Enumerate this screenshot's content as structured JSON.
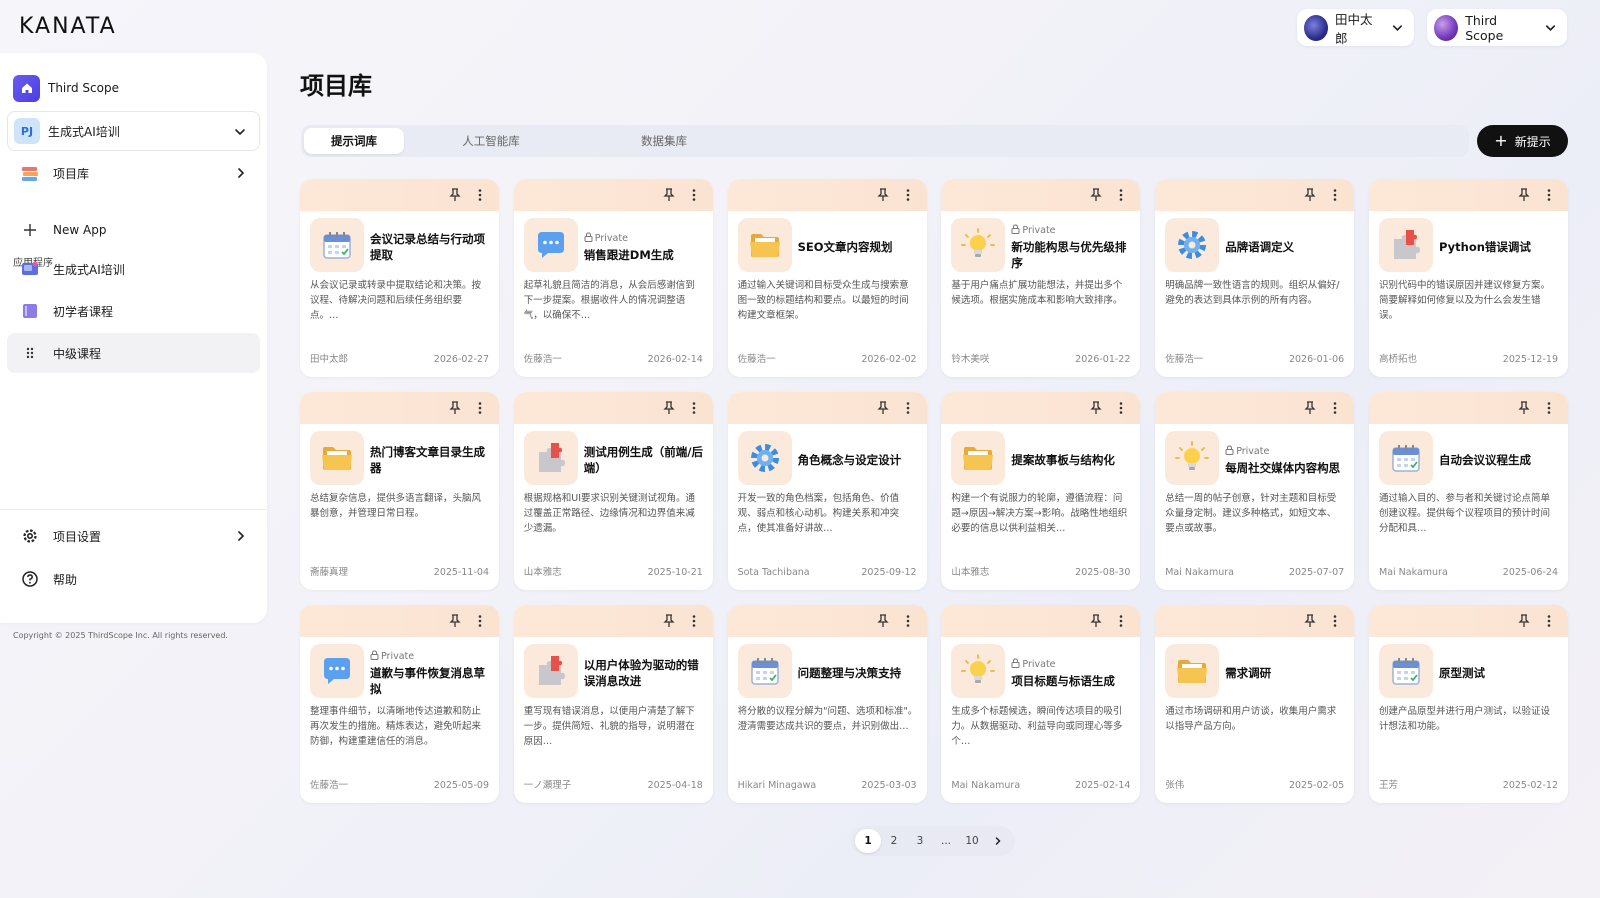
{
  "app": {
    "logo": "KANATA"
  },
  "header": {
    "user": {
      "name": "田中太郎"
    },
    "org": {
      "name": "Third Scope"
    }
  },
  "sidebar": {
    "workspace": "Third Scope",
    "project": {
      "badge": "PJ",
      "name": "生成式AI培训"
    },
    "library": "项目库",
    "section_label": "应用程序",
    "apps": [
      "New App",
      "生成式AI培训",
      "初学者课程",
      "中级课程"
    ],
    "settings": "项目设置",
    "help": "帮助"
  },
  "copyright": "Copyright © 2025 ThirdScope Inc. All rights reserved.",
  "page": {
    "title": "项目库",
    "tabs": [
      "提示词库",
      "人工智能库",
      "数据集库"
    ],
    "active_tab": "提示词库",
    "new_button": "新提示"
  },
  "cards": [
    {
      "icon": "calendar-icon",
      "private": false,
      "title": "会议记录总结与行动项提取",
      "desc": "从会议记录或转录中提取结论和决策。按议程、待解决问题和后续任务组织要点。…",
      "author": "田中太郎",
      "date": "2026-02-27"
    },
    {
      "icon": "chat-bubble-icon",
      "private": true,
      "title": "销售跟进DM生成",
      "desc": "起草礼貌且简洁的消息，从会后感谢信到下一步提案。根据收件人的情况调整语气，以确保不…",
      "author": "佐藤浩一",
      "date": "2026-02-14"
    },
    {
      "icon": "folder-icon",
      "private": false,
      "title": "SEO文章内容规划",
      "desc": "通过输入关键词和目标受众生成与搜索意图一致的标题结构和要点。以最短的时间构建文章框架。",
      "author": "佐藤浩一",
      "date": "2026-02-02"
    },
    {
      "icon": "lightbulb-icon",
      "private": true,
      "title": "新功能构思与优先级排序",
      "desc": "基于用户痛点扩展功能想法，并提出多个候选项。根据实施成本和影响大致排序。",
      "author": "铃木美咲",
      "date": "2026-01-22"
    },
    {
      "icon": "gear-icon",
      "private": false,
      "title": "品牌语调定义",
      "desc": "明确品牌一致性语言的规则。组织从偏好/避免的表达到具体示例的所有内容。",
      "author": "佐藤浩一",
      "date": "2026-01-06"
    },
    {
      "icon": "puzzle-icon",
      "private": false,
      "title": "Python错误调试",
      "desc": "识别代码中的错误原因并建议修复方案。简要解释如何修复以及为什么会发生错误。",
      "author": "高桥拓也",
      "date": "2025-12-19"
    },
    {
      "icon": "folder-icon",
      "private": false,
      "title": "热门博客文章目录生成器",
      "desc": "总结复杂信息，提供多语言翻译，头脑风暴创意，并管理日常日程。",
      "author": "斋藤真理",
      "date": "2025-11-04"
    },
    {
      "icon": "puzzle-icon",
      "private": false,
      "title": "测试用例生成（前端/后端）",
      "desc": "根据规格和UI要求识别关键测试视角。通过覆盖正常路径、边缘情况和边界值来减少遗漏。",
      "author": "山本雅志",
      "date": "2025-10-21"
    },
    {
      "icon": "gear-icon",
      "private": false,
      "title": "角色概念与设定设计",
      "desc": "开发一致的角色档案，包括角色、价值观、弱点和核心动机。构建关系和冲突点，使其准备好讲故…",
      "author": "Sota Tachibana",
      "date": "2025-09-12"
    },
    {
      "icon": "folder-icon",
      "private": false,
      "title": "提案故事板与结构化",
      "desc": "构建一个有说服力的轮廓，遵循流程：问题→原因→解决方案→影响。战略性地组织必要的信息以供利益相关…",
      "author": "山本雅志",
      "date": "2025-08-30"
    },
    {
      "icon": "lightbulb-icon",
      "private": true,
      "title": "每周社交媒体内容构思",
      "desc": "总结一周的帖子创意，针对主题和目标受众量身定制。建议多种格式，如短文本、要点或故事。",
      "author": "Mai Nakamura",
      "date": "2025-07-07"
    },
    {
      "icon": "calendar-icon",
      "private": false,
      "title": "自动会议议程生成",
      "desc": "通过输入目的、参与者和关键讨论点简单创建议程。提供每个议程项目的预计时间分配和具…",
      "author": "Mai Nakamura",
      "date": "2025-06-24"
    },
    {
      "icon": "chat-bubble-icon",
      "private": true,
      "title": "道歉与事件恢复消息草拟",
      "desc": "整理事件细节，以清晰地传达道歉和防止再次发生的措施。精炼表达，避免听起来防御，构建重建信任的消息。",
      "author": "佐藤浩一",
      "date": "2025-05-09"
    },
    {
      "icon": "puzzle-icon",
      "private": false,
      "title": "以用户体验为驱动的错误消息改进",
      "desc": "重写现有错误消息，以便用户清楚了解下一步。提供简短、礼貌的指导，说明潜在原因…",
      "author": "一ノ瀬理子",
      "date": "2025-04-18"
    },
    {
      "icon": "calendar-icon",
      "private": false,
      "title": "问题整理与决策支持",
      "desc": "将分散的议程分解为\"问题、选项和标准\"。澄清需要达成共识的要点，并识别做出…",
      "author": "Hikari Minagawa",
      "date": "2025-03-03"
    },
    {
      "icon": "lightbulb-icon",
      "private": true,
      "title": "项目标题与标语生成",
      "desc": "生成多个标题候选，瞬间传达项目的吸引力。从数据驱动、利益导向或同理心等多个…",
      "author": "Mai Nakamura",
      "date": "2025-02-14"
    },
    {
      "icon": "folder-icon",
      "private": false,
      "title": "需求调研",
      "desc": "通过市场调研和用户访谈，收集用户需求以指导产品方向。",
      "author": "张伟",
      "date": "2025-02-05"
    },
    {
      "icon": "calendar-icon",
      "private": false,
      "title": "原型测试",
      "desc": "创建产品原型并进行用户测试，以验证设计想法和功能。",
      "author": "王芳",
      "date": "2025-02-12"
    }
  ],
  "private_label": "Private",
  "pagination": {
    "pages": [
      "1",
      "2",
      "3",
      "...",
      "10"
    ],
    "current": "1"
  }
}
